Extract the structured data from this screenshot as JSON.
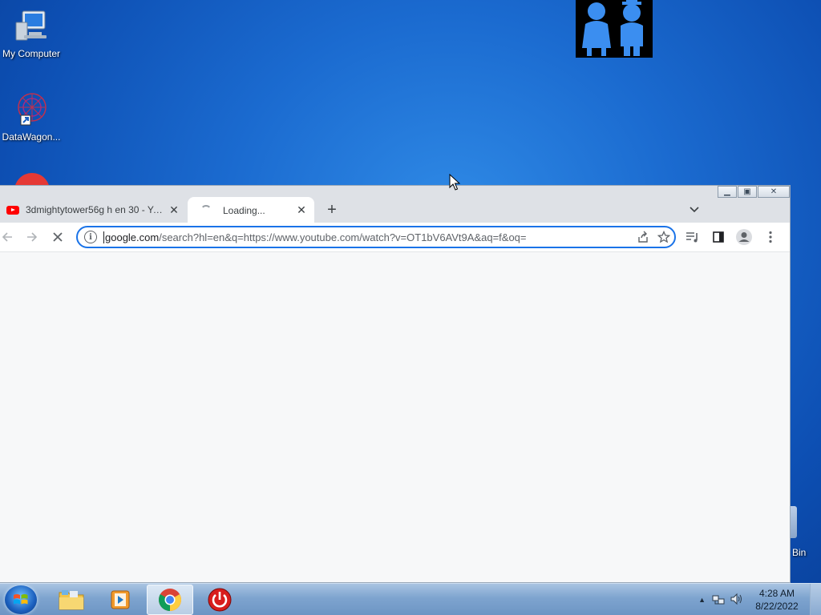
{
  "desktop": {
    "icons": [
      {
        "label": "My Computer"
      },
      {
        "label": "DataWagon..."
      }
    ],
    "recycle_bin_label": "Bin"
  },
  "browser": {
    "tabs": [
      {
        "title": "3dmightytower56g h en 30 - YouTube",
        "favicon": "youtube-icon"
      },
      {
        "title": "Loading...",
        "favicon": "loading-spinner"
      }
    ],
    "new_tab_symbol": "+",
    "address_bar": {
      "host": "google.com",
      "path": "/search?hl=en&q=https://www.youtube.com/watch?v=OT1bV6AVt9A&aq=f&oq="
    }
  },
  "taskbar": {
    "clock_time": "4:28 AM",
    "clock_date": "8/22/2022"
  },
  "colors": {
    "accent": "#1a73e8",
    "youtube_red": "#ff0000"
  }
}
